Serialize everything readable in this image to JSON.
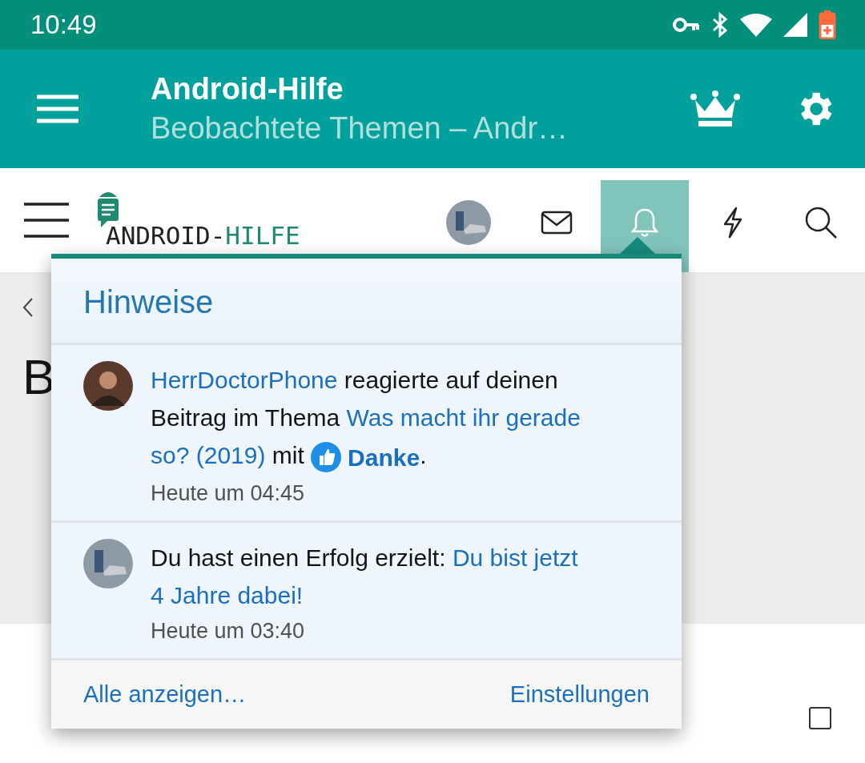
{
  "status_bar": {
    "time": "10:49"
  },
  "app_bar": {
    "title": "Android-Hilfe",
    "subtitle": "Beobachtete Themen – Andr…"
  },
  "site_header": {
    "logo": [
      "ANDROID-",
      "HILFE"
    ],
    "nav": [
      {
        "kind": "avatar",
        "selected": false
      },
      {
        "kind": "mail",
        "selected": false
      },
      {
        "kind": "bell",
        "selected": true
      },
      {
        "kind": "flash",
        "selected": false
      },
      {
        "kind": "search",
        "selected": false
      }
    ]
  },
  "page": {
    "heading": "B",
    "checkbox": {
      "checked": false
    }
  },
  "popup": {
    "title": "Hinweise",
    "items": [
      {
        "time": "Heute um 04:45",
        "parts": [
          {
            "kind": "link",
            "text": "HerrDoctorPhone"
          },
          {
            "kind": "text",
            "text": " reagierte auf deinen Beitrag im Thema "
          },
          {
            "kind": "link",
            "text": "Was macht ihr gerade"
          },
          {
            "kind": "link",
            "text": "so? (2019)"
          },
          {
            "kind": "text",
            "text": " mit "
          },
          {
            "kind": "reaction",
            "text": "Danke"
          },
          {
            "kind": "text",
            "text": "."
          }
        ]
      },
      {
        "time": "Heute um 03:40",
        "parts": [
          {
            "kind": "text",
            "text": "Du hast einen Erfolg erzielt: "
          },
          {
            "kind": "link",
            "text": "Du bist jetzt"
          },
          {
            "kind": "link",
            "text": "4 Jahre dabei!"
          }
        ]
      }
    ],
    "footer": [
      "Alle anzeigen…",
      "Einstellungen"
    ]
  }
}
